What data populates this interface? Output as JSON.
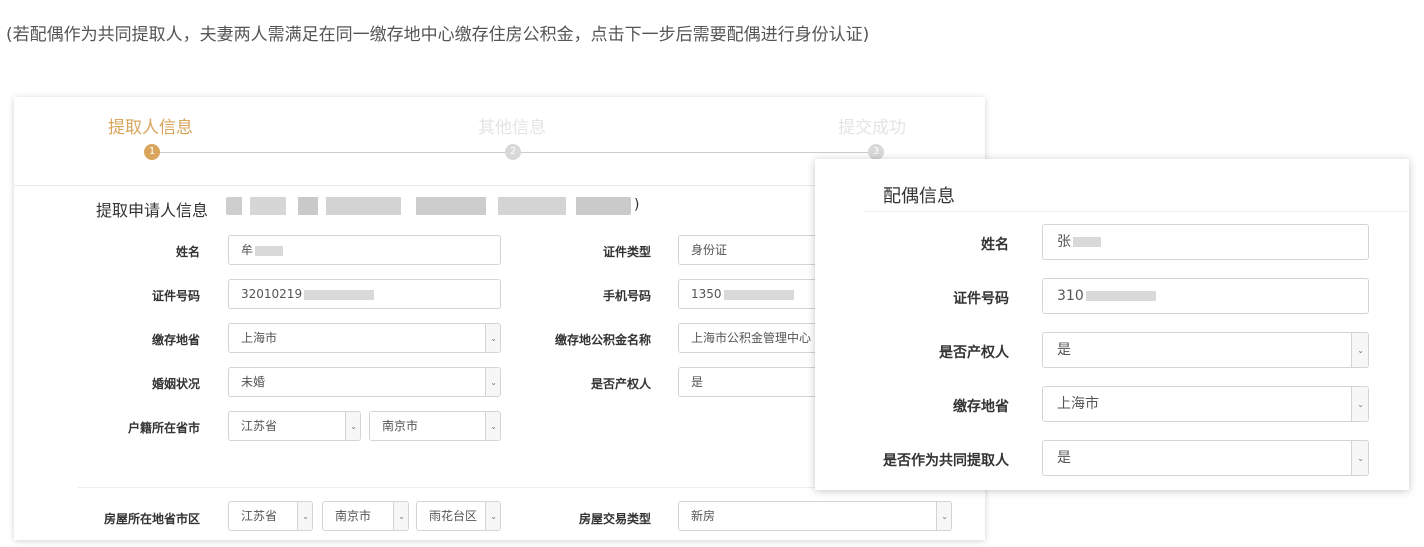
{
  "notice": "(若配偶作为共同提取人，夫妻两人需满足在同一缴存地中心缴存住房公积金，点击下一步后需要配偶进行身份认证)",
  "steps": [
    {
      "label": "提取人信息",
      "num": "1",
      "state": "active"
    },
    {
      "label": "其他信息",
      "num": "2",
      "state": "inactive"
    },
    {
      "label": "提交成功",
      "num": "3",
      "state": "inactive"
    }
  ],
  "applicant": {
    "section_title": "提取申请人信息",
    "section_suffix": ")",
    "name": {
      "label": "姓名",
      "value": "牟"
    },
    "id_type": {
      "label": "证件类型",
      "value": "身份证"
    },
    "id_number": {
      "label": "证件号码",
      "value": "32010219"
    },
    "phone": {
      "label": "手机号码",
      "value": "1350"
    },
    "deposit_province": {
      "label": "缴存地省",
      "value": "上海市"
    },
    "fund_name": {
      "label": "缴存地公积金名称",
      "value": "上海市公积金管理中心"
    },
    "marital_status": {
      "label": "婚姻状况",
      "value": "未婚"
    },
    "is_owner": {
      "label": "是否产权人",
      "value": "是"
    },
    "household": {
      "label": "户籍所在省市",
      "province": "江苏省",
      "city": "南京市"
    }
  },
  "property": {
    "location": {
      "label": "房屋所在地省市区",
      "province": "江苏省",
      "city": "南京市",
      "district": "雨花台区"
    },
    "trade_type": {
      "label": "房屋交易类型",
      "value": "新房"
    }
  },
  "spouse": {
    "title": "配偶信息",
    "name": {
      "label": "姓名",
      "value": "张"
    },
    "id_number": {
      "label": "证件号码",
      "value": "310"
    },
    "is_owner": {
      "label": "是否产权人",
      "value": "是"
    },
    "deposit_province": {
      "label": "缴存地省",
      "value": "上海市"
    },
    "co_withdrawer": {
      "label": "是否作为共同提取人",
      "value": "是"
    }
  },
  "icons": {
    "dropdown": "chevron-down-icon"
  },
  "colors": {
    "accent": "#d9a55c",
    "inactive_step": "#e4e4e4"
  }
}
